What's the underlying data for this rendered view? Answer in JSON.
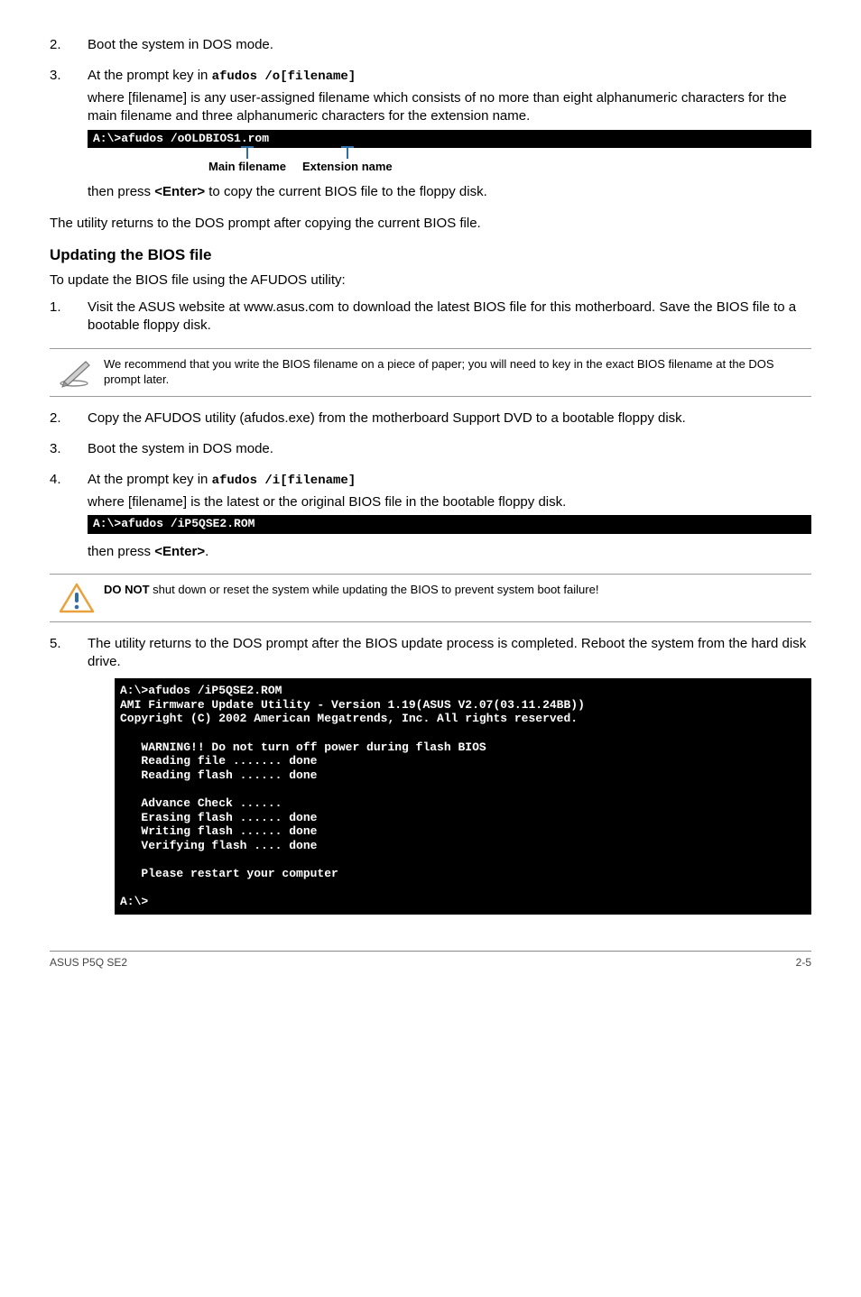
{
  "step2": {
    "num": "2.",
    "text": "Boot the system in DOS mode."
  },
  "step3": {
    "num": "3.",
    "lead": "At the prompt key in ",
    "cmd": "afudos /o[filename]",
    "desc": "where [filename] is any user-assigned filename which consists of no more than eight alphanumeric characters for the main filename and three alphanumeric characters for the extension name.",
    "box": "A:\\>afudos /oOLDBIOS1.rom",
    "label_main": "Main filename",
    "label_ext": "Extension name",
    "then_a": "then press ",
    "enter": "<Enter>",
    "then_b": " to copy the current BIOS file to the floppy disk."
  },
  "utility_returns": "The utility returns to the DOS prompt after copying the current BIOS file.",
  "heading_update": "Updating the BIOS file",
  "intro_update": "To update the BIOS file using the AFUDOS utility:",
  "u1": {
    "num": "1.",
    "text": "Visit the ASUS website at www.asus.com to download the latest BIOS file for this motherboard. Save the BIOS file to a bootable floppy disk."
  },
  "note1": "We recommend that you write the BIOS filename on a piece of paper; you will need to key in the exact BIOS filename at the DOS prompt later.",
  "u2": {
    "num": "2.",
    "text": "Copy the AFUDOS utility (afudos.exe) from the motherboard Support DVD to a bootable floppy disk."
  },
  "u3": {
    "num": "3.",
    "text": "Boot the system in DOS mode."
  },
  "u4": {
    "num": "4.",
    "lead": "At the prompt key in ",
    "cmd": "afudos /i[filename]",
    "desc": "where [filename] is the latest or the original BIOS file in the bootable floppy disk.",
    "box": "A:\\>afudos /iP5QSE2.ROM",
    "then_a": "then press ",
    "enter": "<Enter>",
    "then_b": "."
  },
  "note2_a": "DO NOT",
  "note2_b": " shut down or reset the system while updating the BIOS to prevent system boot failure!",
  "u5": {
    "num": "5.",
    "text": "The utility returns to the DOS prompt after the BIOS update process is completed. Reboot the system from the hard disk drive.",
    "box": "A:\\>afudos /iP5QSE2.ROM\nAMI Firmware Update Utility - Version 1.19(ASUS V2.07(03.11.24BB))\nCopyright (C) 2002 American Megatrends, Inc. All rights reserved.\n\n   WARNING!! Do not turn off power during flash BIOS\n   Reading file ....... done\n   Reading flash ...... done\n\n   Advance Check ......\n   Erasing flash ...... done\n   Writing flash ...... done\n   Verifying flash .... done\n\n   Please restart your computer\n\nA:\\>"
  },
  "footer_left": "ASUS P5Q SE2",
  "footer_right": "2-5"
}
